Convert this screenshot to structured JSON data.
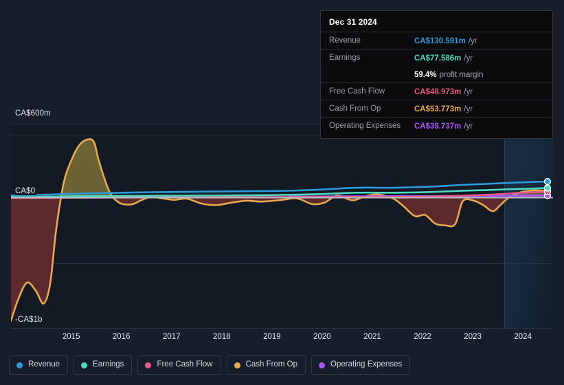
{
  "chart_data": {
    "type": "line",
    "title": "",
    "currency": "CA$",
    "xlabel": "",
    "ylabel": "",
    "ylim": [
      -1000,
      600
    ],
    "y_ticks": [
      "CA$600m",
      "CA$0",
      "-CA$1b"
    ],
    "x_ticks": [
      "2015",
      "2016",
      "2017",
      "2018",
      "2019",
      "2020",
      "2021",
      "2022",
      "2023",
      "2024"
    ],
    "grid": true,
    "legend_position": "bottom",
    "zero_line": true,
    "forecast_region_start": "2023.6",
    "series": [
      {
        "name": "Revenue",
        "color": "#2d9bdb",
        "end_value_label": "CA$130.591m",
        "points": [
          [
            2014.3,
            18
          ],
          [
            2014.6,
            20
          ],
          [
            2015.0,
            24
          ],
          [
            2015.4,
            30
          ],
          [
            2016.0,
            36
          ],
          [
            2016.5,
            40
          ],
          [
            2017.0,
            44
          ],
          [
            2017.5,
            46
          ],
          [
            2018.0,
            48
          ],
          [
            2018.5,
            50
          ],
          [
            2019.0,
            52
          ],
          [
            2019.5,
            54
          ],
          [
            2020.0,
            58
          ],
          [
            2020.5,
            66
          ],
          [
            2021.0,
            78
          ],
          [
            2021.4,
            82
          ],
          [
            2021.8,
            80
          ],
          [
            2022.3,
            84
          ],
          [
            2022.8,
            92
          ],
          [
            2023.3,
            104
          ],
          [
            2023.8,
            112
          ],
          [
            2024.2,
            120
          ],
          [
            2024.6,
            126
          ],
          [
            2024.99,
            130.591
          ]
        ]
      },
      {
        "name": "Earnings",
        "color": "#4fd8c0",
        "end_value_label": "CA$77.586m",
        "points": [
          [
            2014.3,
            4
          ],
          [
            2014.6,
            5
          ],
          [
            2015.0,
            8
          ],
          [
            2015.4,
            11
          ],
          [
            2016.0,
            13
          ],
          [
            2016.5,
            14
          ],
          [
            2017.0,
            15
          ],
          [
            2017.5,
            16
          ],
          [
            2018.0,
            17
          ],
          [
            2018.5,
            18
          ],
          [
            2019.0,
            19
          ],
          [
            2019.5,
            21
          ],
          [
            2020.0,
            24
          ],
          [
            2020.5,
            30
          ],
          [
            2021.0,
            38
          ],
          [
            2021.4,
            41
          ],
          [
            2021.8,
            40
          ],
          [
            2022.3,
            42
          ],
          [
            2022.8,
            48
          ],
          [
            2023.3,
            56
          ],
          [
            2023.8,
            62
          ],
          [
            2024.2,
            68
          ],
          [
            2024.6,
            73
          ],
          [
            2024.99,
            77.586
          ]
        ]
      },
      {
        "name": "Free Cash Flow",
        "color": "#e8568a",
        "end_value_label": "CA$48.973m",
        "points": [
          [
            2014.3,
            -3
          ],
          [
            2015.0,
            -2
          ],
          [
            2016.0,
            0
          ],
          [
            2017.0,
            2
          ],
          [
            2018.0,
            3
          ],
          [
            2019.0,
            4
          ],
          [
            2020.0,
            5
          ],
          [
            2021.0,
            6
          ],
          [
            2022.0,
            7
          ],
          [
            2023.0,
            12
          ],
          [
            2023.8,
            24
          ],
          [
            2024.4,
            38
          ],
          [
            2024.99,
            48.973
          ]
        ]
      },
      {
        "name": "Cash From Op",
        "color": "#e8a94f",
        "end_value_label": "CA$53.773m",
        "fill": true,
        "points": [
          [
            2014.3,
            -1000
          ],
          [
            2014.45,
            -820
          ],
          [
            2014.62,
            -690
          ],
          [
            2014.8,
            -760
          ],
          [
            2014.95,
            -860
          ],
          [
            2015.08,
            -700
          ],
          [
            2015.2,
            -260
          ],
          [
            2015.35,
            120
          ],
          [
            2015.5,
            300
          ],
          [
            2015.65,
            420
          ],
          [
            2015.8,
            470
          ],
          [
            2015.95,
            455
          ],
          [
            2016.05,
            300
          ],
          [
            2016.25,
            60
          ],
          [
            2016.45,
            -40
          ],
          [
            2016.7,
            -55
          ],
          [
            2016.9,
            -20
          ],
          [
            2017.1,
            8
          ],
          [
            2017.3,
            -5
          ],
          [
            2017.55,
            -18
          ],
          [
            2017.8,
            -8
          ],
          [
            2018.1,
            -48
          ],
          [
            2018.4,
            -60
          ],
          [
            2018.7,
            -40
          ],
          [
            2019.0,
            -25
          ],
          [
            2019.3,
            -32
          ],
          [
            2019.7,
            -18
          ],
          [
            2020.0,
            -6
          ],
          [
            2020.3,
            -52
          ],
          [
            2020.55,
            -40
          ],
          [
            2020.8,
            18
          ],
          [
            2021.1,
            -22
          ],
          [
            2021.35,
            10
          ],
          [
            2021.6,
            26
          ],
          [
            2021.9,
            -4
          ],
          [
            2022.1,
            -62
          ],
          [
            2022.35,
            -150
          ],
          [
            2022.55,
            -140
          ],
          [
            2022.75,
            -210
          ],
          [
            2022.95,
            -225
          ],
          [
            2023.15,
            -215
          ],
          [
            2023.3,
            -30
          ],
          [
            2023.5,
            -22
          ],
          [
            2023.7,
            -58
          ],
          [
            2023.9,
            -110
          ],
          [
            2024.05,
            -60
          ],
          [
            2024.25,
            10
          ],
          [
            2024.5,
            48
          ],
          [
            2024.75,
            60
          ],
          [
            2024.99,
            53.773
          ]
        ]
      },
      {
        "name": "Operating Expenses",
        "color": "#a855f7",
        "end_value_label": "CA$39.737m",
        "points": [
          [
            2019.85,
            8
          ],
          [
            2020.5,
            9
          ],
          [
            2021.2,
            10
          ],
          [
            2022.0,
            11
          ],
          [
            2022.8,
            12
          ],
          [
            2023.5,
            14
          ],
          [
            2024.2,
            16
          ],
          [
            2024.99,
            18
          ]
        ]
      }
    ]
  },
  "tooltip": {
    "date": "Dec 31 2024",
    "rows": [
      {
        "label": "Revenue",
        "value": "CA$130.591m",
        "unit": "/yr",
        "color": "#2d9bdb"
      },
      {
        "label": "Earnings",
        "value": "CA$77.586m",
        "unit": "/yr",
        "color": "#4fd8c0"
      },
      {
        "label": "Free Cash Flow",
        "value": "CA$48.973m",
        "unit": "/yr",
        "color": "#e8568a"
      },
      {
        "label": "Cash From Op",
        "value": "CA$53.773m",
        "unit": "/yr",
        "color": "#e8a94f"
      },
      {
        "label": "Operating Expenses",
        "value": "CA$39.737m",
        "unit": "/yr",
        "color": "#a855f7"
      }
    ],
    "profit_margin_value": "59.4%",
    "profit_margin_label": "profit margin"
  },
  "axis": {
    "y_top": "CA$600m",
    "y_zero": "CA$0",
    "y_bottom": "-CA$1b",
    "x_ticks": [
      "2015",
      "2016",
      "2017",
      "2018",
      "2019",
      "2020",
      "2021",
      "2022",
      "2023",
      "2024"
    ]
  },
  "legend": {
    "items": [
      {
        "label": "Revenue",
        "color": "#2d9bdb"
      },
      {
        "label": "Earnings",
        "color": "#4fd8c0"
      },
      {
        "label": "Free Cash Flow",
        "color": "#e8568a"
      },
      {
        "label": "Cash From Op",
        "color": "#e8a94f"
      },
      {
        "label": "Operating Expenses",
        "color": "#a855f7"
      }
    ]
  },
  "colors": {
    "page_bg": "#171e29",
    "plot_bg": "#131a24",
    "gridline": "#2a3440",
    "zero_line": "#b9bcc2",
    "positive_area": "#6b6334",
    "negative_area": "#5c2a2c"
  }
}
